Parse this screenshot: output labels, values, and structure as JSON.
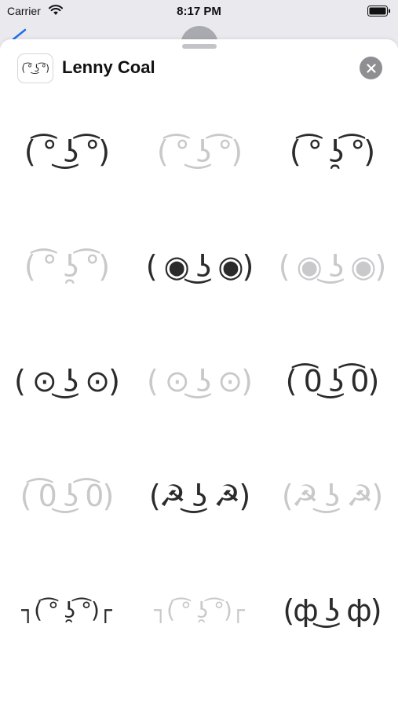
{
  "status_bar": {
    "carrier": "Carrier",
    "time": "8:17 PM",
    "icons": [
      "wifi-icon",
      "battery-icon"
    ]
  },
  "sheet": {
    "app_name": "Lenny Coal",
    "app_icon_face": "( ͡° ͜ʖ ͡°)",
    "close_icon": "close-icon"
  },
  "colors": {
    "sticker_ink": "#2b2b2b",
    "sticker_faded": "#c9c9cc",
    "close_button": "#8e8e93",
    "sheet_background": "#ffffff"
  },
  "stickers": [
    {
      "face": "( ͡° ͜ʖ ͡°)",
      "state": "normal"
    },
    {
      "face": "( ͡° ͜ʖ ͡°)",
      "state": "faded"
    },
    {
      "face": "( ͡° ʖ̯ ͡°)",
      "state": "normal"
    },
    {
      "face": "( ͡° ʖ̯ ͡°)",
      "state": "faded"
    },
    {
      "face": "( ◉ ͜ʖ ◉)",
      "state": "normal"
    },
    {
      "face": "( ◉ ͜ʖ ◉)",
      "state": "faded"
    },
    {
      "face": "( ⊙ ͜ʖ ⊙)",
      "state": "normal"
    },
    {
      "face": "( ⊙ ͜ʖ ⊙)",
      "state": "faded"
    },
    {
      "face": "( ͡0 ͜ʖ ͡0)",
      "state": "normal"
    },
    {
      "face": "( ͡0 ͜ʖ ͡0)",
      "state": "faded"
    },
    {
      "face": "(☭ ͜ʖ ☭)",
      "state": "normal"
    },
    {
      "face": "(☭ ͜ʖ ☭)",
      "state": "faded"
    },
    {
      "face": "┐( ͡° ʖ̯ ͡°)┌",
      "state": "normal"
    },
    {
      "face": "┐( ͡° ʖ̯ ͡°)┌",
      "state": "faded"
    },
    {
      "face": "(ф ͜ʖ ф)",
      "state": "normal"
    }
  ]
}
